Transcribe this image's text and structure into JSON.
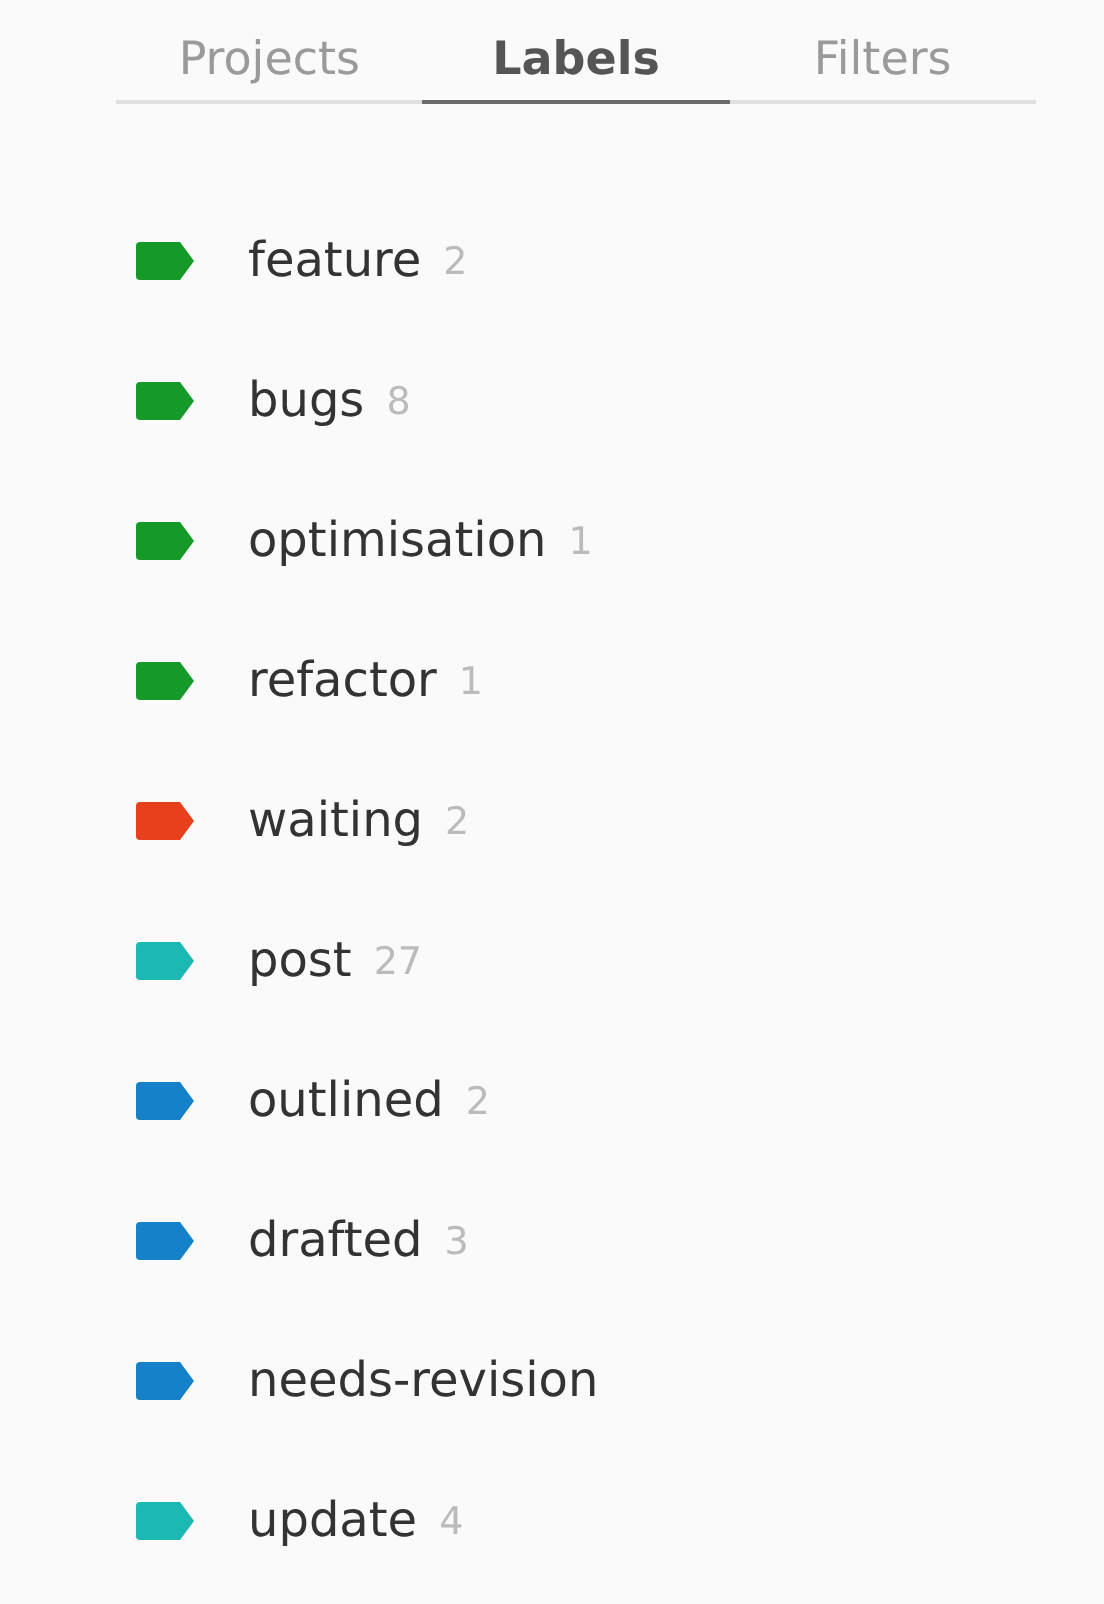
{
  "tabs": [
    {
      "label": "Projects",
      "selected": false
    },
    {
      "label": "Labels",
      "selected": true
    },
    {
      "label": "Filters",
      "selected": false
    }
  ],
  "labels": [
    {
      "name": "feature",
      "count": "2",
      "color": "#159a2a"
    },
    {
      "name": "bugs",
      "count": "8",
      "color": "#159a2a"
    },
    {
      "name": "optimisation",
      "count": "1",
      "color": "#159a2a"
    },
    {
      "name": "refactor",
      "count": "1",
      "color": "#159a2a"
    },
    {
      "name": "waiting",
      "count": "2",
      "color": "#e8401c"
    },
    {
      "name": "post",
      "count": "27",
      "color": "#1cb8b3"
    },
    {
      "name": "outlined",
      "count": "2",
      "color": "#1481c8"
    },
    {
      "name": "drafted",
      "count": "3",
      "color": "#1481c8"
    },
    {
      "name": "needs-revision",
      "color": "#1481c8"
    },
    {
      "name": "update",
      "count": "4",
      "color": "#1cb8b3"
    }
  ]
}
